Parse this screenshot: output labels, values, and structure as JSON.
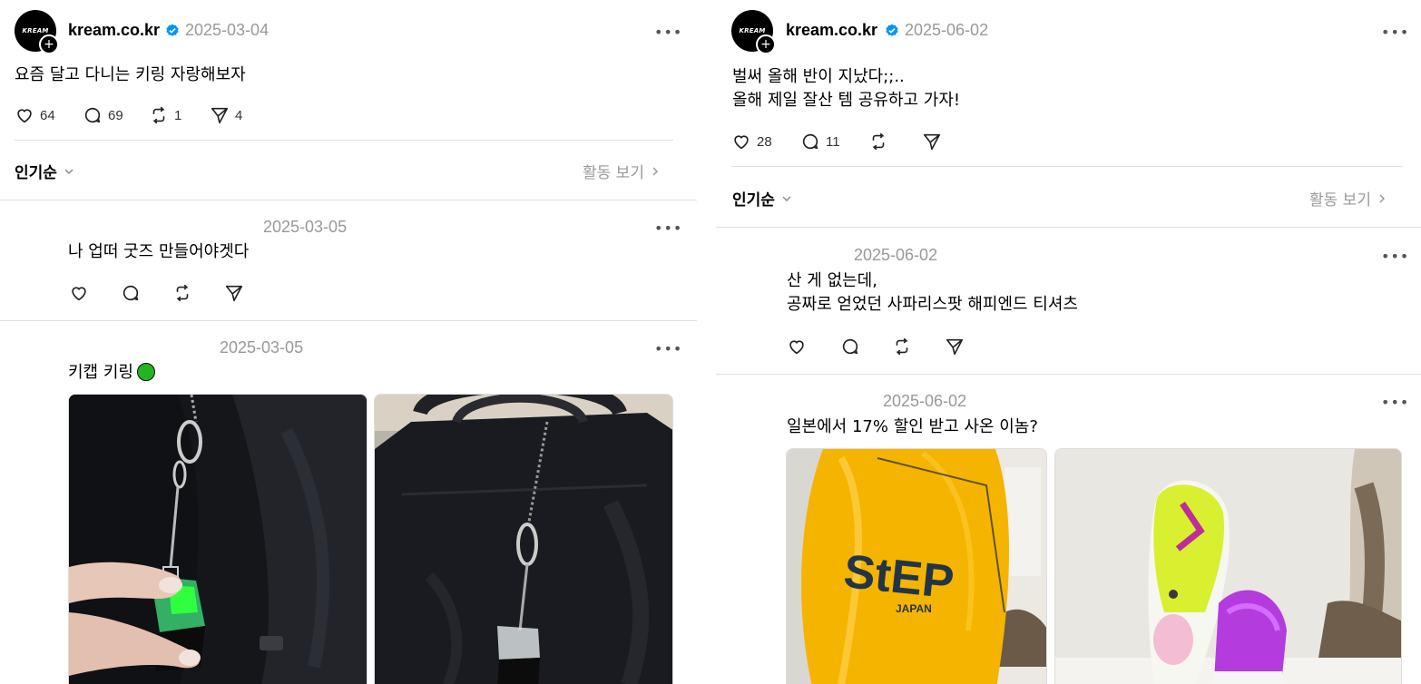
{
  "left": {
    "post": {
      "username": "kream.co.kr",
      "date": "2025-03-04",
      "text": "요즘 달고 다니는 키링 자랑해보자",
      "likes": "64",
      "comments": "69",
      "reposts": "1",
      "shares": "4",
      "avatar_logo": "KREAM"
    },
    "sort_label": "인기순",
    "activity_label": "활동 보기",
    "replies": [
      {
        "date": "2025-03-05",
        "text": "나 업떠 굿즈 만들어야겟다"
      },
      {
        "date": "2025-03-05",
        "text": "키캡 키링",
        "emoji": "green-circle"
      }
    ]
  },
  "right": {
    "post": {
      "username": "kream.co.kr",
      "date": "2025-06-02",
      "text_line1": "벌써 올해 반이 지났다;;..",
      "text_line2": "올해 제일 잘산 템 공유하고 가자!",
      "likes": "28",
      "comments": "11",
      "avatar_logo": "KREAM"
    },
    "sort_label": "인기순",
    "activity_label": "활동 보기",
    "replies": [
      {
        "date": "2025-06-02",
        "line1": "산 게 없는데,",
        "line2": "공짜로 얻었던 사파리스팟 해피엔드 티셔츠"
      },
      {
        "date": "2025-06-02",
        "text": "일본에서 17% 할인 받고 사온 이놈?"
      }
    ],
    "bag_brand": "StEP",
    "bag_sub": "JAPAN"
  },
  "colors": {
    "verified": "#0095f6",
    "muted": "#999999",
    "divider": "#e0e0e0",
    "emoji_green": "#22b522"
  }
}
